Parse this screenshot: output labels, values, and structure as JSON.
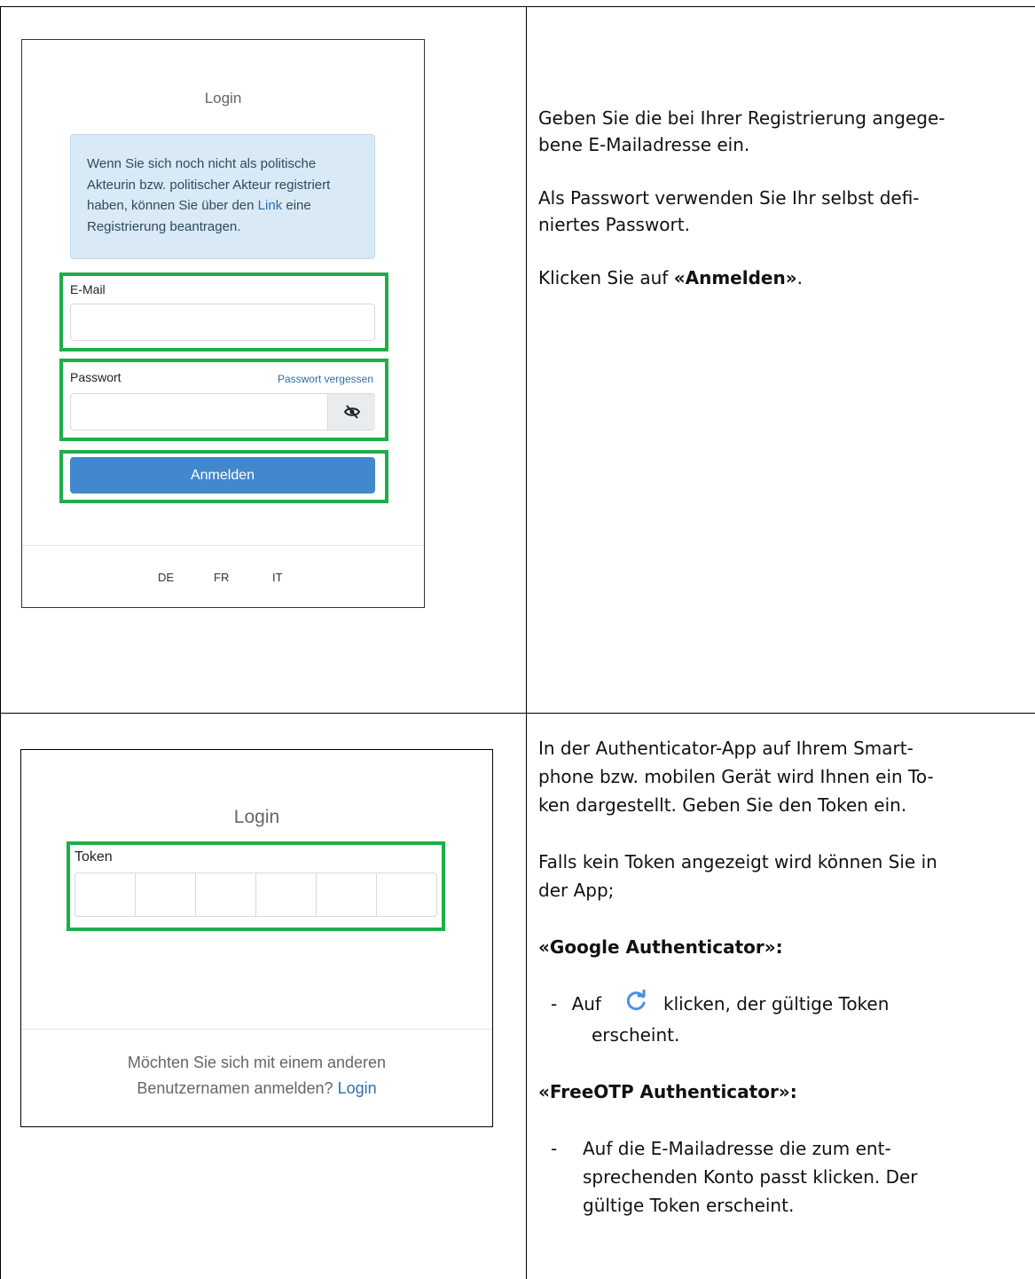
{
  "step1": {
    "screenshot": {
      "title": "Login",
      "info_text": "Wenn Sie sich noch nicht als politische Akteurin bzw. politischer Akteur registriert haben, können Sie über den",
      "info_link": "Link",
      "info_text_after": "eine Registrierung beantragen.",
      "email_label": "E-Mail",
      "email_value": "",
      "password_label": "Passwort",
      "password_value": "",
      "forgot_password": "Passwort vergessen",
      "login_button": "Anmelden",
      "languages": [
        "DE",
        "FR",
        "IT"
      ],
      "highlight_color": "#1eae4a",
      "button_color": "#4188cd"
    },
    "instructions": {
      "p1_line1": "Geben Sie die bei Ihrer Registrierung angege-",
      "p1_line2": "bene E-Mailadresse ein.",
      "p2_line1": "Als Passwort verwenden Sie Ihr selbst defi-",
      "p2_line2": "niertes Passwort.",
      "p3_pre": "Klicken Sie auf ",
      "p3_bold": "«Anmelden»",
      "p3_post": "."
    }
  },
  "step2": {
    "screenshot": {
      "title": "Login",
      "token_label": "Token",
      "token_cells": 6,
      "alt_login_line1": "Möchten Sie sich mit einem anderen",
      "alt_login_line2": "Benutzernamen anmelden?",
      "alt_login_link": "Login"
    },
    "instructions": {
      "p1_line1": "In der Authenticator-App auf Ihrem Smart-",
      "p1_line2": "phone bzw. mobilen Gerät wird Ihnen ein To-",
      "p1_line3": "ken dargestellt. Geben Sie den Token ein.",
      "p2_line1": "Falls kein Token angezeigt wird können Sie in",
      "p2_line2": "der App;",
      "google_heading": "«Google Authenticator»:",
      "google_bullet_pre": "Auf",
      "google_bullet_post": "klicken, der gültige Token",
      "google_bullet_line2": "erscheint.",
      "freeotp_heading": "«FreeOTP Authenticator»:",
      "freeotp_line1": "Auf die E-Mailadresse die zum ent-",
      "freeotp_line2": "sprechenden Konto passt klicken. Der",
      "freeotp_line3": "gültige Token erscheint.",
      "bullet": "-",
      "refresh_icon": "refresh-icon"
    }
  }
}
